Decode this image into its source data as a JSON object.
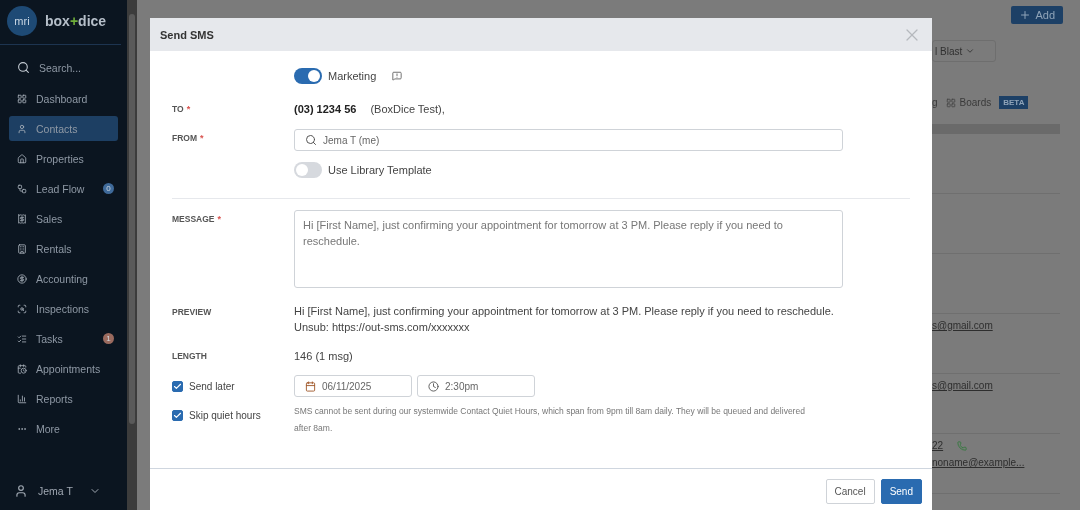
{
  "sidebar": {
    "logo": {
      "mark": "mri",
      "brand_left": "box",
      "brand_plus": "+",
      "brand_right": "dice"
    },
    "search": {
      "placeholder": "Search..."
    },
    "items": [
      {
        "label": "Dashboard",
        "selected": false
      },
      {
        "label": "Contacts",
        "selected": true
      },
      {
        "label": "Properties",
        "selected": false
      },
      {
        "label": "Lead Flow",
        "selected": false,
        "badge": "0",
        "color": "#3f6a9a"
      },
      {
        "label": "Sales",
        "selected": false
      },
      {
        "label": "Rentals",
        "selected": false
      },
      {
        "label": "Accounting",
        "selected": false
      },
      {
        "label": "Inspections",
        "selected": false
      },
      {
        "label": "Tasks",
        "selected": false,
        "badge": "1",
        "color": "#9a6a5e"
      },
      {
        "label": "Appointments",
        "selected": false
      },
      {
        "label": "Reports",
        "selected": false
      },
      {
        "label": "More",
        "selected": false
      }
    ],
    "user": {
      "name": "Jema T"
    }
  },
  "background": {
    "add_button": "Add",
    "blast_dropdown": "l Blast",
    "view_tab": "g",
    "boards_tab": "Boards",
    "beta_badge": "BETA",
    "emails": [
      "s@gmail.com",
      "s@gmail.com"
    ],
    "phone": "22",
    "last_email": "noname@example..."
  },
  "dialog": {
    "title": "Send SMS",
    "marketing": {
      "label": "Marketing",
      "on": true
    },
    "to": {
      "label": "TO",
      "required": "*",
      "number": "(03) 1234 56",
      "name": "(BoxDice Test),"
    },
    "from": {
      "label": "FROM",
      "required": "*",
      "placeholder": "Jema T (me)"
    },
    "library_template": {
      "label": "Use Library Template",
      "on": false
    },
    "message": {
      "label": "MESSAGE",
      "required": "*",
      "value": "Hi [First Name], just confirming your appointment for tomorrow at 3 PM. Please reply if you need to reschedule."
    },
    "preview": {
      "label": "PREVIEW",
      "lines": [
        "Hi [First Name], just confirming your appointment for tomorrow at 3 PM. Please reply if you need to reschedule.",
        "Unsub: https://out-sms.com/xxxxxxx"
      ]
    },
    "length": {
      "label": "LENGTH",
      "value": "146 (1 msg)"
    },
    "send_later": {
      "label": "Send later",
      "checked": true,
      "date": "06/11/2025",
      "time": "2:30pm"
    },
    "skip_quiet_hours": {
      "label": "Skip quiet hours",
      "checked": true,
      "note": "SMS cannot be sent during our systemwide Contact Quiet Hours, which span from 9pm till 8am daily. They will be queued and delivered after 8am."
    },
    "buttons": {
      "cancel": "Cancel",
      "send": "Send"
    }
  }
}
